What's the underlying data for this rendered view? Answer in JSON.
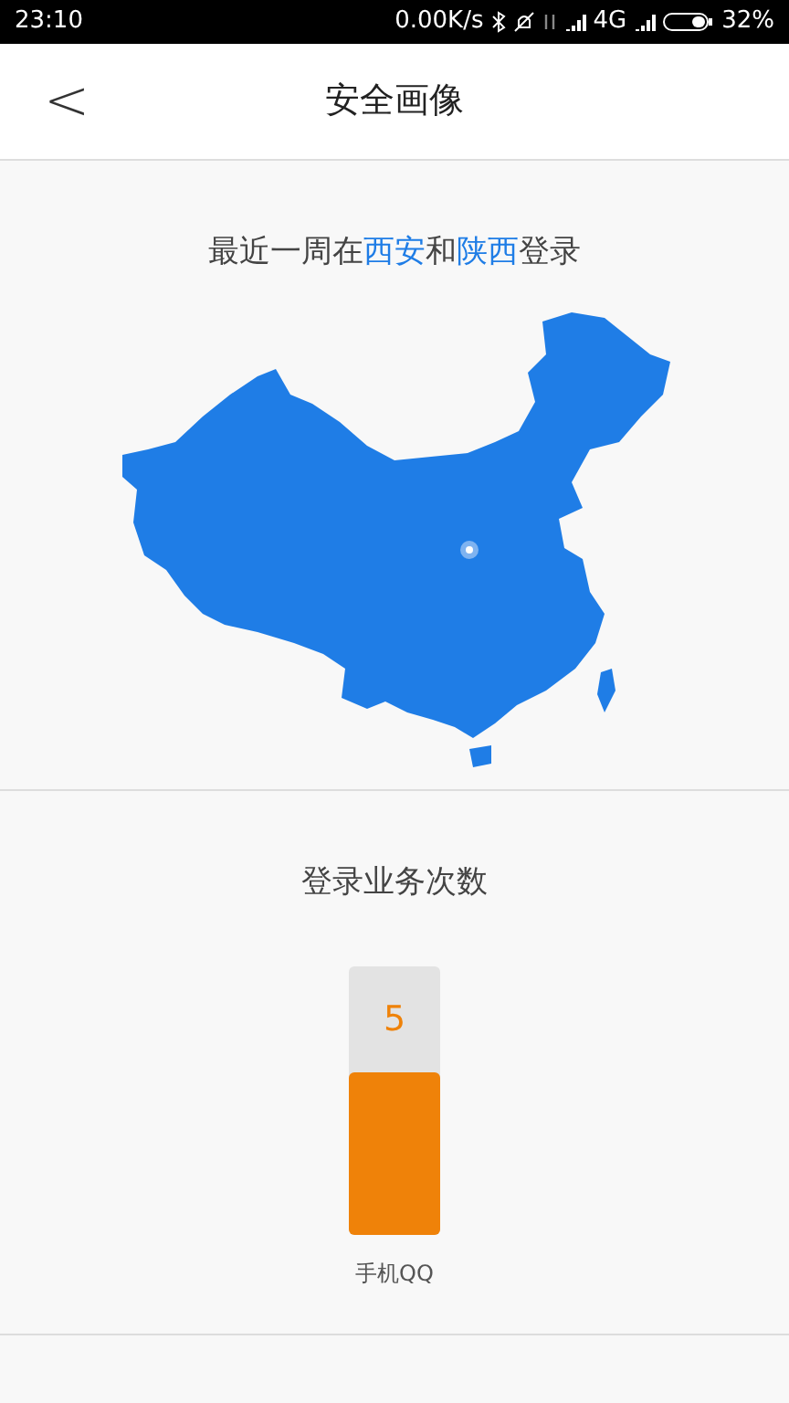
{
  "status_bar": {
    "time": "23:10",
    "speed": "0.00K/s",
    "network": "4G",
    "battery": "32%"
  },
  "header": {
    "back": "<",
    "title": "安全画像"
  },
  "location": {
    "segments": [
      {
        "text": "最近一周在",
        "highlight": false
      },
      {
        "text": "西安",
        "highlight": true
      },
      {
        "text": "和",
        "highlight": false
      },
      {
        "text": "陕西",
        "highlight": true
      },
      {
        "text": "登录",
        "highlight": false
      }
    ]
  },
  "logins": {
    "title": "登录业务次数",
    "bars": [
      {
        "label": "手机QQ",
        "count": "5",
        "level": 0.6
      }
    ]
  }
}
